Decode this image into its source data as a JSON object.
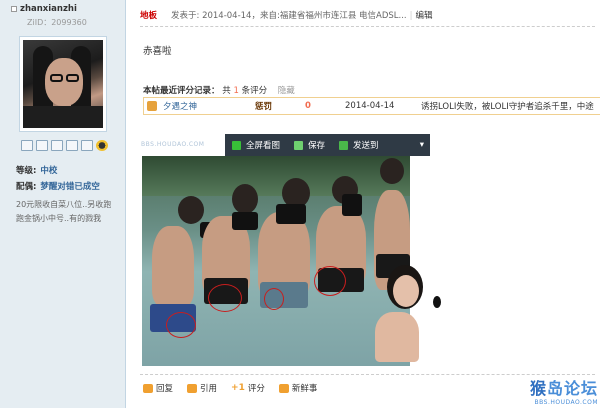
{
  "user": {
    "name": "zhanxianzhi",
    "uid": "ZiID：2099360",
    "rank_label": "等级:",
    "rank_value": "中校",
    "medal_label": "配偶:",
    "medal_value": "梦醒对错已成空",
    "signature": "20元限收自菜八位..另收跑跑金锅小中号..有的戮我"
  },
  "post": {
    "floor": "地板",
    "meta": "发表于: 2014-04-14，来自:福建省福州市连江县 电信ADSL...",
    "edit_label": "编辑",
    "content": "赤喜啦",
    "rating_title": "本帖最近评分记录：",
    "rating_total_prefix": "共",
    "rating_total": "1",
    "rating_total_suffix": "条评分",
    "rating_hide": "隐藏",
    "rating_row": {
      "user": "夕遇之神",
      "action": "惩罚",
      "score": "0",
      "date": "2014-04-14",
      "reason": "诱拐LOLI失败，被LOLI守护者追杀千里，中途"
    }
  },
  "image_toolbar": {
    "fullscreen": "全屏看图",
    "save": "保存",
    "send": "发送到",
    "more": "▾"
  },
  "image_watermark_top": "BBS.HOUDAO.COM",
  "actions": {
    "reply": "回复",
    "quote": "引用",
    "rate": "评分",
    "rate_plus": "+1",
    "news": "新鲜事"
  },
  "site_watermark": {
    "title_a": "猴",
    "title_b": "岛论坛",
    "url": "BBS.HOUDAO.COM"
  },
  "colors": {
    "sidebar_bg": "#e5edf2",
    "floor_red": "#cc0000",
    "link_blue": "#336699",
    "score_orange": "#f26c4f",
    "toolbar_bg": "#2f3a45"
  }
}
